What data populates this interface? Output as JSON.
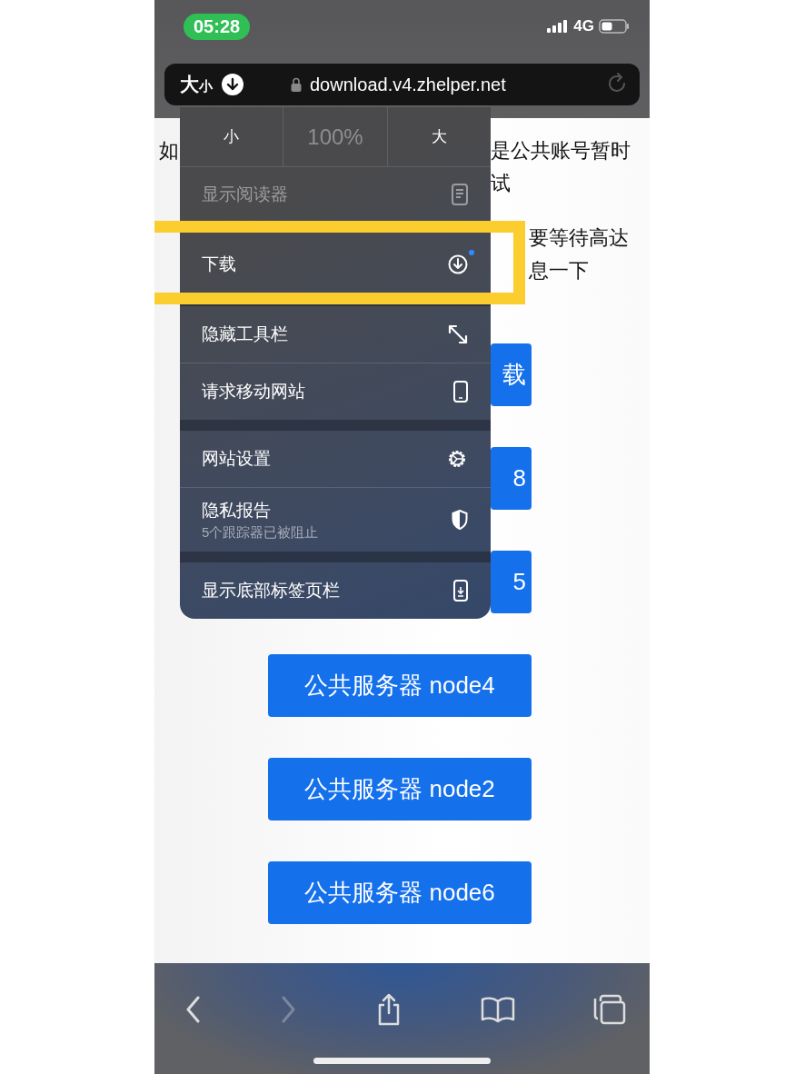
{
  "status_bar": {
    "time": "05:28",
    "network": "4G"
  },
  "address_bar": {
    "format_big": "大",
    "format_small": "小",
    "url": "download.v4.zhelper.net"
  },
  "page": {
    "lines": [
      {
        "left": "如",
        "right": "是公共账号暂时"
      },
      {
        "right": "试"
      },
      {
        "right": "要等待高达"
      },
      {
        "right": "息一下"
      }
    ],
    "buttons": [
      {
        "label": "载",
        "partial": true
      },
      {
        "label": "8",
        "partial": true
      },
      {
        "label": "5",
        "partial": true
      },
      {
        "label": "公共服务器 node4",
        "partial": false
      },
      {
        "label": "公共服务器 node2",
        "partial": false
      },
      {
        "label": "公共服务器 node6",
        "partial": false
      }
    ]
  },
  "menu": {
    "zoom": [
      {
        "label": "小",
        "disabled": false
      },
      {
        "label": "100%",
        "disabled": true
      },
      {
        "label": "大",
        "disabled": false
      }
    ],
    "sections": [
      [
        {
          "label": "显示阅读器",
          "disabled": true,
          "unread": false
        },
        {
          "label": "下载",
          "disabled": false,
          "unread": true
        }
      ],
      [
        {
          "label": "隐藏工具栏",
          "disabled": false,
          "unread": false
        },
        {
          "label": "请求移动网站",
          "disabled": false,
          "unread": false
        }
      ],
      [
        {
          "label": "网站设置",
          "disabled": false,
          "unread": false
        },
        {
          "label": "隐私报告",
          "subtitle": "5个跟踪器已被阻止",
          "disabled": false,
          "unread": false
        }
      ],
      [
        {
          "label": "显示底部标签页栏",
          "disabled": false,
          "unread": false
        }
      ]
    ]
  },
  "highlight": {
    "shown": true
  },
  "toolbar": [
    {
      "kind": "back",
      "disabled": false
    },
    {
      "kind": "forward",
      "disabled": true
    },
    {
      "kind": "share",
      "disabled": false
    },
    {
      "kind": "bookmarks",
      "disabled": false
    },
    {
      "kind": "tabs",
      "disabled": false
    }
  ]
}
